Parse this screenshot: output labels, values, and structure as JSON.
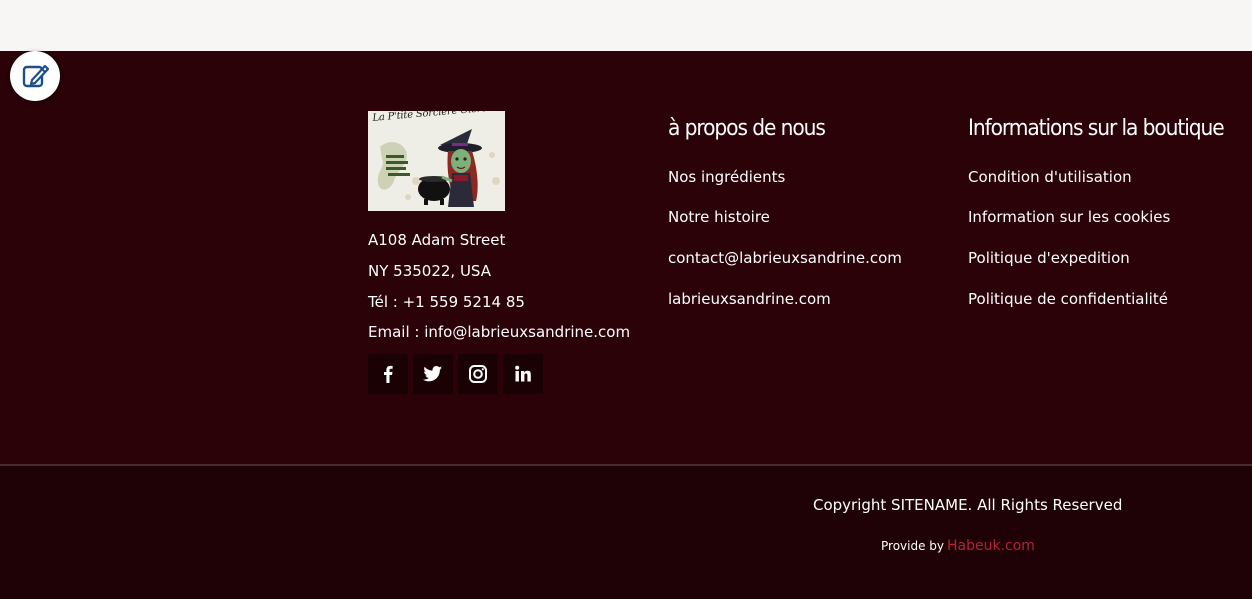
{
  "colors": {
    "footer_bg": "#2a0207",
    "bottom_bg": "#1f0205",
    "topbar_bg": "#f7f6f5",
    "link_accent": "#b6203e",
    "text": "#ffffff"
  },
  "edit_button": {
    "icon": "edit-icon"
  },
  "brand": {
    "logo_text": "La P'tite Sorcière Oléronaise",
    "address_line1": "A108 Adam Street",
    "address_line2": "NY 535022, USA",
    "phone": "Tél : +1 559 5214 85",
    "email": "Email : info@labrieuxsandrine.com"
  },
  "social": [
    {
      "name": "facebook-icon"
    },
    {
      "name": "twitter-icon"
    },
    {
      "name": "instagram-icon"
    },
    {
      "name": "linkedin-icon"
    }
  ],
  "about": {
    "title": "à propos de nous",
    "links": [
      "Nos ingrédients",
      "Notre histoire",
      "contact@labrieuxsandrine.com",
      "labrieuxsandrine.com"
    ]
  },
  "shop_info": {
    "title": "Informations sur la boutique",
    "links": [
      "Condition d'utilisation",
      "Information sur les cookies",
      "Politique d'expedition",
      "Politique de confidentialité"
    ]
  },
  "bottom": {
    "copyright": "Copyright SITENAME. All Rights Reserved",
    "provide_label": "Provide by",
    "provider": "Habeuk.com"
  }
}
